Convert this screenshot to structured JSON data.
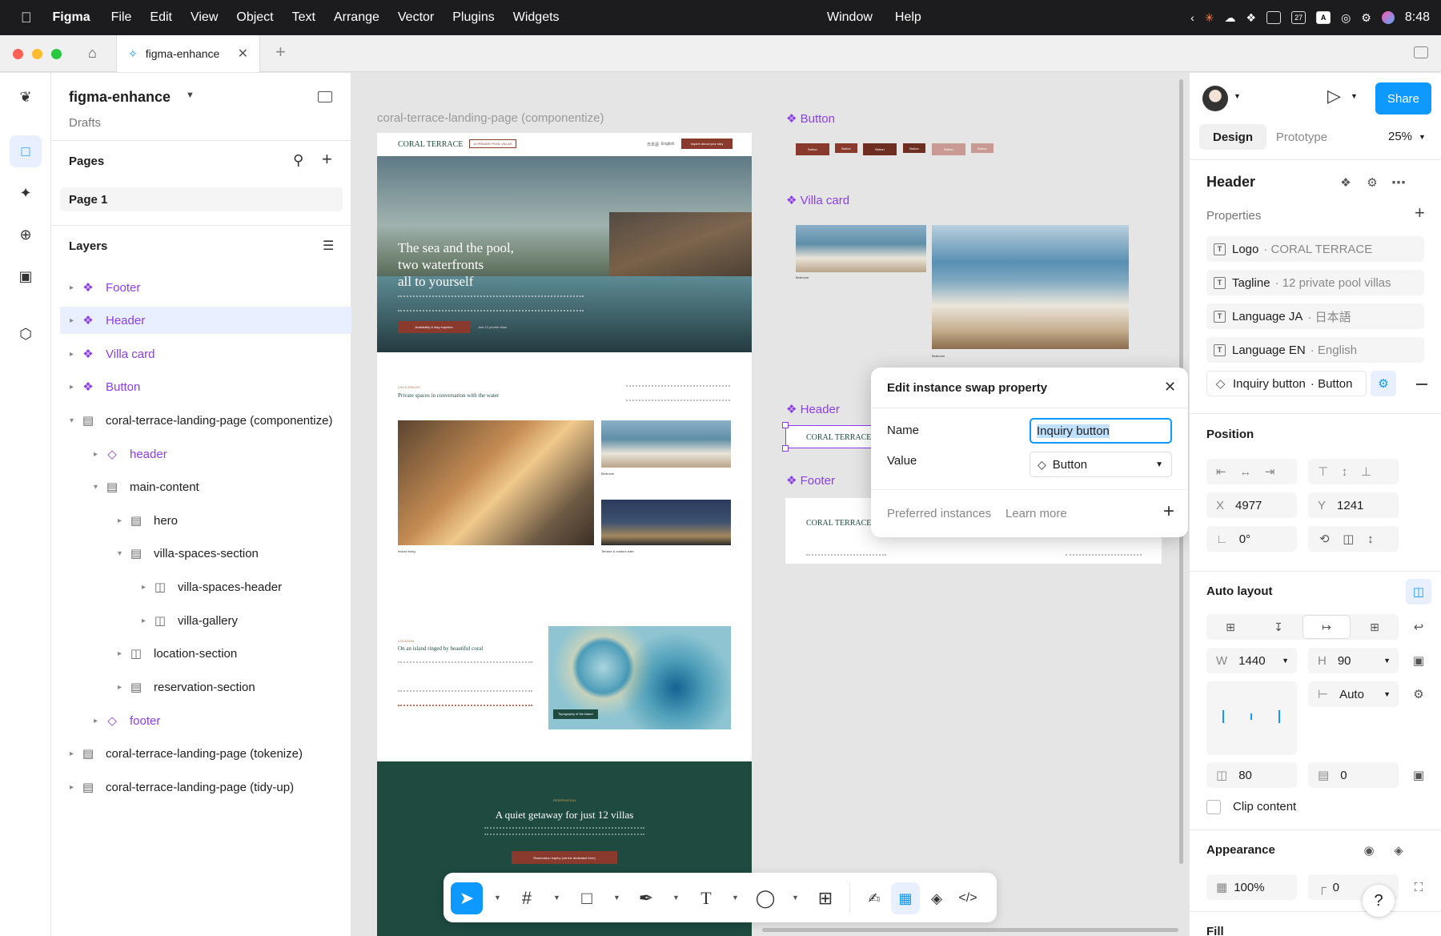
{
  "menubar": {
    "app": "Figma",
    "items": [
      "File",
      "Edit",
      "View",
      "Object",
      "Text",
      "Arrange",
      "Vector",
      "Plugins",
      "Widgets"
    ],
    "center_items": [
      "Window",
      "Help"
    ],
    "date_badge": "27",
    "input_badge": "A",
    "clock": "8:48"
  },
  "tabs": {
    "file_tab": "figma-enhance",
    "add": "+"
  },
  "file": {
    "name": "figma-enhance",
    "location": "Drafts"
  },
  "pages": {
    "title": "Pages",
    "items": [
      "Page 1"
    ]
  },
  "layers": {
    "title": "Layers",
    "items": [
      {
        "label": "Footer"
      },
      {
        "label": "Header"
      },
      {
        "label": "Villa card"
      },
      {
        "label": "Button"
      },
      {
        "label": "coral-terrace-landing-page (componentize)"
      },
      {
        "label": "header"
      },
      {
        "label": "main-content"
      },
      {
        "label": "hero"
      },
      {
        "label": "villa-spaces-section"
      },
      {
        "label": "villa-spaces-header"
      },
      {
        "label": "villa-gallery"
      },
      {
        "label": "location-section"
      },
      {
        "label": "reservation-section"
      },
      {
        "label": "footer"
      },
      {
        "label": "coral-terrace-landing-page (tokenize)"
      },
      {
        "label": "coral-terrace-landing-page (tidy-up)"
      }
    ]
  },
  "canvas": {
    "frame_title": "coral-terrace-landing-page (componentize)",
    "labels": {
      "button": "Button",
      "villa_card": "Villa card",
      "header": "Header",
      "footer": "Footer"
    },
    "site": {
      "brand": "CORAL TERRACE",
      "tagline": "12 PRIVATE POOL VILLAS",
      "lang_ja": "日本語",
      "lang_en": "English",
      "cta": "Inquire about your stay",
      "hero_title_1": "The sea and the pool,",
      "hero_title_2": "two waterfronts",
      "hero_title_3": "all to yourself",
      "hero_btn": "Availability & stay inquiries",
      "hero_note": "Just 12 private villas",
      "spaces_kicker": "VILLA SPACES",
      "spaces_title": "Private spaces in conversation with the water",
      "cap_indoor": "Indoor living",
      "cap_bedroom": "Bedroom",
      "cap_terrace": "Terrace & outdoor bath",
      "loc_kicker": "LOCATION",
      "loc_title": "On an island ringed by beautiful coral",
      "map_caption": "Topography of the island",
      "res_kicker": "RESERVATION",
      "res_title": "A quiet getaway for just 12 villas",
      "res_btn": "Reservation inquiry (via the dedicated form)",
      "button_sample": "Button",
      "card_title": "Bedroom"
    }
  },
  "dialog": {
    "title": "Edit instance swap property",
    "name_label": "Name",
    "name_value": "Inquiry button",
    "value_label": "Value",
    "value_value": "Button",
    "preferred": "Preferred instances",
    "learn_more": "Learn more"
  },
  "rightpanel": {
    "share": "Share",
    "tab_design": "Design",
    "tab_prototype": "Prototype",
    "zoom": "25%",
    "selection": "Header",
    "properties_title": "Properties",
    "properties": [
      {
        "key": "Logo",
        "value": "CORAL TERRACE"
      },
      {
        "key": "Tagline",
        "value": "12 private pool villas"
      },
      {
        "key": "Language JA",
        "value": "日本語"
      },
      {
        "key": "Language EN",
        "value": "English"
      },
      {
        "key": "Inquiry button",
        "value": "Button"
      }
    ],
    "position_title": "Position",
    "x_label": "X",
    "x": "4977",
    "y_label": "Y",
    "y": "1241",
    "rotation": "0°",
    "autolayout_title": "Auto layout",
    "w_label": "W",
    "w": "1440",
    "h_label": "H",
    "h": "90",
    "gap": "Auto",
    "padding_h": "80",
    "padding_v": "0",
    "clip": "Clip content",
    "appearance_title": "Appearance",
    "opacity": "100%",
    "radius": "0",
    "fill_title": "Fill",
    "help": "?"
  },
  "colors": {
    "accent": "#0d99ff",
    "component": "#8b3df0",
    "brand": "#8a3a2c",
    "dark_green": "#1e4a40"
  }
}
